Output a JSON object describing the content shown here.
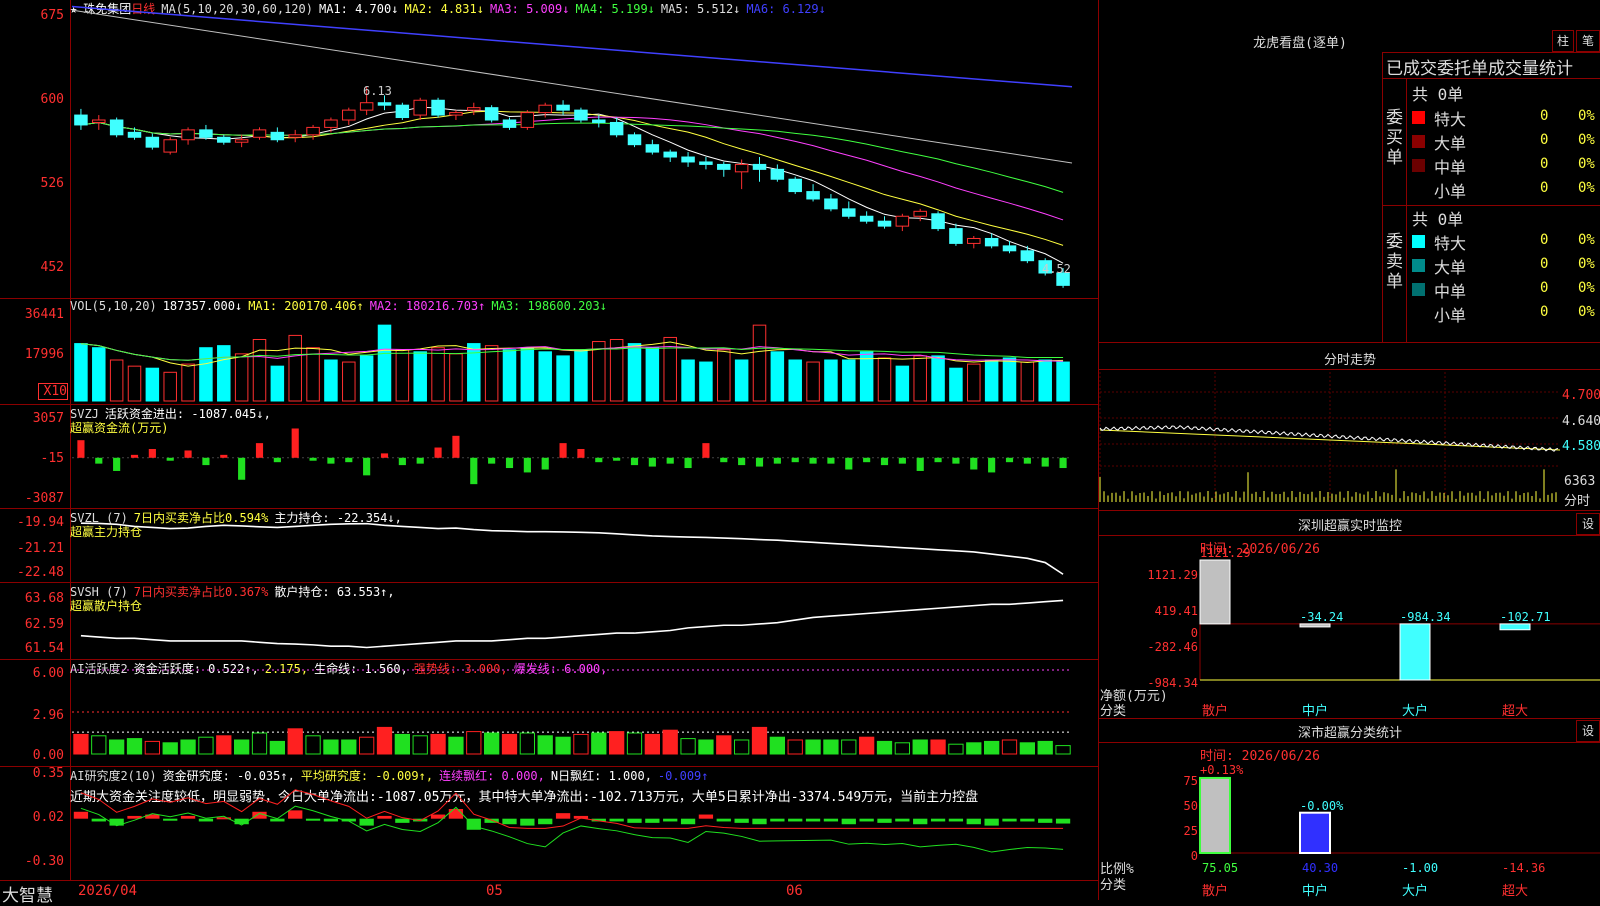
{
  "header": {
    "star": "★",
    "stock_name": "珠免集团",
    "period": "日线",
    "ma_main": "MA(5,10,20,30,60,120)",
    "ma1": "MA1: 4.700↓",
    "ma2": "MA2: 4.831↓",
    "ma3": "MA3: 5.009↓",
    "ma4": "MA4: 5.199↓",
    "ma5": "MA5: 5.512↓",
    "ma6": "MA6: 6.129↓"
  },
  "vol_header": {
    "name": "VOL(5,10,20)",
    "v": "187357.000↓",
    "ma1": "MA1: 200170.406↑",
    "ma2": "MA2: 180216.703↑",
    "ma3": "MA3: 198600.203↓"
  },
  "svzj_header": {
    "a": "SVZJ",
    "b": "活跃资金进出: -1087.045↓,",
    "c": "超赢资金流(万元)"
  },
  "svzl_header": {
    "a": "SVZL (7)",
    "b": "7日内买卖净占比0.594%",
    "c": "主力持仓: -22.354↓,",
    "d": "超赢主力持仓"
  },
  "svsh_header": {
    "a": "SVSH (7)",
    "b": "7日内买卖净占比0.367%",
    "c": "散户持仓: 63.553↑,",
    "d": "超赢散户持仓"
  },
  "ai1_header": {
    "a": "AI活跃度2",
    "b": "资金活跃度: 0.522↑,",
    "c": "2.175,",
    "d": "生命线: 1.560,",
    "e": "强势线: 3.000,",
    "f": "爆发线: 6.000,"
  },
  "ai2_header": {
    "a": "AI研究度2(10)",
    "b": "资金研究度: -0.035↑,",
    "c": "平均研究度: -0.009↑,",
    "d": "连续飘红: 0.000,",
    "e": "N日飘红: 1.000,",
    "f": "-0.009↑"
  },
  "ai2_note": "近期大资金关注度较低，明显弱势，今日大单净流出:-1087.05万元，其中特大单净流出:-102.713万元，大单5日累计净出-3374.549万元，当前主力控盘",
  "axis": {
    "price": [
      "675",
      "600",
      "526",
      "452"
    ],
    "vol": [
      "36441",
      "17996",
      "X10"
    ],
    "svzj": [
      "3057",
      "-15",
      "-3087"
    ],
    "svzl": [
      "-19.94",
      "-21.21",
      "-22.48"
    ],
    "svsh": [
      "63.68",
      "62.59",
      "61.54"
    ],
    "ai1": [
      "6.00",
      "2.96",
      "0.00"
    ],
    "ai2": [
      "0.35",
      "0.02",
      "-0.30"
    ]
  },
  "price_annotations": {
    "high": "6.13",
    "low": "4.52"
  },
  "date_axis": {
    "start": "2026/04",
    "m5": "05",
    "m6": "06"
  },
  "bottom_left": "大智慧",
  "longhu": {
    "title": "龙虎看盘(逐单)",
    "btn1": "柱",
    "btn2": "笔",
    "subtitle": "已成交委托单成交量统计",
    "buy_label": "委买单",
    "sell_label": "委卖单",
    "buy_total": "共 0单",
    "sell_total": "共 0单",
    "buy_rows": [
      {
        "name": "特大",
        "count": "0",
        "pct": "0%",
        "color": "#ff0000"
      },
      {
        "name": "大单",
        "count": "0",
        "pct": "0%",
        "color": "#8b0000"
      },
      {
        "name": "中单",
        "count": "0",
        "pct": "0%",
        "color": "#6b0000"
      },
      {
        "name": "小单",
        "count": "0",
        "pct": "0%",
        "color": "#000000"
      }
    ],
    "sell_rows": [
      {
        "name": "特大",
        "count": "0",
        "pct": "0%",
        "color": "#00ffff"
      },
      {
        "name": "大单",
        "count": "0",
        "pct": "0%",
        "color": "#008b8b"
      },
      {
        "name": "中单",
        "count": "0",
        "pct": "0%",
        "color": "#007070"
      },
      {
        "name": "小单",
        "count": "0",
        "pct": "0%",
        "color": "#000000"
      }
    ]
  },
  "intraday": {
    "title": "分时走势",
    "labels": [
      "4.700",
      "4.640",
      "4.580"
    ],
    "vol_label": "6363",
    "time_label": "分时"
  },
  "monitor": {
    "title": "深圳超赢实时监控",
    "btn": "设",
    "time": "时间: 2026/06/26",
    "unit": "净额(万元)",
    "cat_title": "分类",
    "axis": [
      "1121.29",
      "419.41",
      "0",
      "-282.46",
      "-984.34"
    ],
    "cats": [
      "散户",
      "中户",
      "大户",
      "超大"
    ],
    "values": [
      "1121.29",
      "-34.24",
      "-984.34",
      "-102.71"
    ]
  },
  "classify": {
    "title": "深市超赢分类统计",
    "btn": "设",
    "time": "时间: 2026/06/26",
    "unit": "比例%",
    "cat_title": "分类",
    "axis": [
      "75",
      "50",
      "25",
      "0"
    ],
    "cats": [
      "散户",
      "中户",
      "大户",
      "超大"
    ],
    "values": [
      "75.05",
      "40.30",
      "-1.00",
      "-14.36"
    ],
    "top_labels": [
      "+0.13%",
      "-0.00%"
    ]
  },
  "chart_data": [
    {
      "type": "candlestick",
      "title": "珠免集团 日线",
      "x_labels": [
        "2026/04",
        "05",
        "06"
      ],
      "ylim": [
        4.45,
        6.8
      ],
      "ohlc": [
        [
          5.9,
          5.95,
          5.78,
          5.82
        ],
        [
          5.84,
          5.9,
          5.78,
          5.86
        ],
        [
          5.86,
          5.88,
          5.72,
          5.74
        ],
        [
          5.76,
          5.8,
          5.7,
          5.72
        ],
        [
          5.72,
          5.75,
          5.62,
          5.64
        ],
        [
          5.6,
          5.72,
          5.58,
          5.7
        ],
        [
          5.7,
          5.8,
          5.66,
          5.78
        ],
        [
          5.78,
          5.82,
          5.7,
          5.72
        ],
        [
          5.72,
          5.74,
          5.66,
          5.68
        ],
        [
          5.68,
          5.74,
          5.64,
          5.7
        ],
        [
          5.72,
          5.8,
          5.7,
          5.78
        ],
        [
          5.76,
          5.8,
          5.68,
          5.7
        ],
        [
          5.72,
          5.78,
          5.68,
          5.74
        ],
        [
          5.74,
          5.82,
          5.7,
          5.8
        ],
        [
          5.8,
          5.88,
          5.76,
          5.86
        ],
        [
          5.86,
          5.96,
          5.82,
          5.94
        ],
        [
          5.94,
          6.13,
          5.9,
          6.0
        ],
        [
          6.0,
          6.06,
          5.94,
          5.98
        ],
        [
          5.98,
          6.0,
          5.86,
          5.88
        ],
        [
          5.9,
          6.04,
          5.86,
          6.02
        ],
        [
          6.02,
          6.04,
          5.88,
          5.9
        ],
        [
          5.9,
          5.94,
          5.86,
          5.92
        ],
        [
          5.94,
          6.0,
          5.9,
          5.96
        ],
        [
          5.96,
          5.98,
          5.84,
          5.86
        ],
        [
          5.86,
          5.88,
          5.78,
          5.8
        ],
        [
          5.8,
          5.94,
          5.78,
          5.92
        ],
        [
          5.92,
          6.0,
          5.88,
          5.98
        ],
        [
          5.98,
          6.02,
          5.9,
          5.94
        ],
        [
          5.94,
          5.96,
          5.84,
          5.86
        ],
        [
          5.86,
          5.9,
          5.8,
          5.84
        ],
        [
          5.84,
          5.88,
          5.72,
          5.74
        ],
        [
          5.74,
          5.76,
          5.64,
          5.66
        ],
        [
          5.66,
          5.7,
          5.58,
          5.6
        ],
        [
          5.6,
          5.62,
          5.52,
          5.56
        ],
        [
          5.56,
          5.6,
          5.48,
          5.52
        ],
        [
          5.52,
          5.56,
          5.46,
          5.5
        ],
        [
          5.5,
          5.52,
          5.4,
          5.46
        ],
        [
          5.44,
          5.54,
          5.3,
          5.5
        ],
        [
          5.5,
          5.56,
          5.36,
          5.46
        ],
        [
          5.46,
          5.5,
          5.36,
          5.38
        ],
        [
          5.38,
          5.4,
          5.26,
          5.28
        ],
        [
          5.28,
          5.34,
          5.2,
          5.22
        ],
        [
          5.22,
          5.26,
          5.12,
          5.14
        ],
        [
          5.14,
          5.2,
          5.06,
          5.08
        ],
        [
          5.08,
          5.12,
          5.02,
          5.04
        ],
        [
          5.04,
          5.08,
          4.98,
          5.0
        ],
        [
          5.0,
          5.1,
          4.96,
          5.08
        ],
        [
          5.08,
          5.14,
          5.04,
          5.12
        ],
        [
          5.1,
          5.12,
          4.96,
          4.98
        ],
        [
          4.98,
          5.02,
          4.84,
          4.86
        ],
        [
          4.86,
          4.92,
          4.82,
          4.9
        ],
        [
          4.9,
          4.94,
          4.82,
          4.84
        ],
        [
          4.84,
          4.88,
          4.78,
          4.8
        ],
        [
          4.8,
          4.84,
          4.7,
          4.72
        ],
        [
          4.72,
          4.74,
          4.6,
          4.62
        ],
        [
          4.62,
          4.66,
          4.5,
          4.52
        ]
      ]
    },
    {
      "type": "bar",
      "title": "VOL(5,10,20)",
      "ylim": [
        0,
        40000
      ],
      "values": [
        28000,
        26000,
        20000,
        17000,
        16000,
        14000,
        18000,
        26000,
        27000,
        23000,
        30000,
        17000,
        32000,
        26000,
        20000,
        19000,
        22000,
        37000,
        25000,
        24000,
        26000,
        23000,
        28000,
        27000,
        25000,
        26000,
        24000,
        22000,
        25000,
        29000,
        30000,
        28000,
        26000,
        31000,
        20000,
        19000,
        25000,
        20000,
        37000,
        24000,
        20000,
        19000,
        20000,
        20000,
        24000,
        21000,
        17000,
        22000,
        22000,
        16000,
        18000,
        20000,
        21000,
        19000,
        20000,
        19000
      ],
      "colors_up": [
        false,
        false,
        true,
        true,
        false,
        true,
        true,
        false,
        false,
        true,
        true,
        false,
        true,
        true,
        false,
        true,
        false,
        false,
        true,
        false,
        true,
        true,
        false,
        true,
        false,
        false,
        false,
        false,
        false,
        true,
        true,
        false,
        false,
        true,
        false,
        false,
        true,
        false,
        true,
        false,
        false,
        true,
        false,
        false,
        false,
        true,
        false,
        true,
        false,
        false,
        true,
        false,
        false,
        true,
        false,
        false
      ]
    },
    {
      "type": "bar",
      "title": "超赢资金流(万元)",
      "ylim": [
        -3087,
        3057
      ],
      "values": [
        1200,
        -400,
        -900,
        200,
        600,
        -200,
        500,
        -500,
        200,
        -1500,
        1000,
        -300,
        2000,
        -200,
        -400,
        -300,
        -1200,
        300,
        -500,
        -400,
        700,
        1500,
        -1800,
        -400,
        -700,
        -1000,
        -800,
        1000,
        600,
        -300,
        -200,
        -500,
        -600,
        -400,
        -700,
        1000,
        -300,
        -500,
        -600,
        -400,
        -300,
        -400,
        -400,
        -800,
        -300,
        -500,
        -400,
        -900,
        -300,
        -400,
        -800,
        -1000,
        -300,
        -400,
        -600,
        -700
      ]
    },
    {
      "type": "line",
      "title": "超赢主力持仓",
      "ylim": [
        -22.48,
        -19.94
      ],
      "values": [
        -19.95,
        -19.96,
        -20.0,
        -20.1,
        -20.15,
        -20.2,
        -20.18,
        -20.1,
        -20.05,
        -20.08,
        -20.12,
        -20.15,
        -20.1,
        -20.05,
        -20.0,
        -19.98,
        -19.97,
        -20.05,
        -20.1,
        -20.15,
        -20.2,
        -20.18,
        -20.25,
        -20.3,
        -20.32,
        -20.35,
        -20.35,
        -20.36,
        -20.38,
        -20.4,
        -20.45,
        -20.5,
        -20.55,
        -20.58,
        -20.6,
        -20.62,
        -20.65,
        -20.68,
        -20.72,
        -20.75,
        -20.8,
        -20.85,
        -20.9,
        -20.95,
        -21.0,
        -21.05,
        -21.1,
        -21.15,
        -21.2,
        -21.25,
        -21.3,
        -21.4,
        -21.5,
        -21.6,
        -21.8,
        -22.35
      ]
    },
    {
      "type": "line",
      "title": "超赢散户持仓",
      "ylim": [
        61.54,
        63.68
      ],
      "values": [
        62.2,
        62.15,
        62.1,
        62.1,
        62.05,
        62.0,
        62.0,
        62.0,
        62.0,
        62.0,
        61.95,
        61.9,
        61.88,
        61.85,
        61.8,
        61.8,
        61.75,
        61.8,
        61.85,
        61.9,
        61.95,
        62.0,
        62.0,
        62.0,
        62.05,
        62.1,
        62.1,
        62.15,
        62.2,
        62.25,
        62.3,
        62.3,
        62.35,
        62.4,
        62.5,
        62.55,
        62.6,
        62.6,
        62.65,
        62.7,
        62.8,
        62.9,
        62.95,
        63.0,
        63.05,
        63.1,
        63.15,
        63.2,
        63.25,
        63.3,
        63.35,
        63.4,
        63.4,
        63.45,
        63.5,
        63.55
      ]
    },
    {
      "type": "bar",
      "title": "AI活跃度2",
      "ylim": [
        0,
        6
      ],
      "values": [
        1.4,
        1.3,
        1.0,
        1.1,
        0.9,
        0.8,
        1.0,
        1.2,
        1.3,
        1.0,
        1.5,
        0.9,
        1.8,
        1.3,
        1.0,
        1.0,
        1.2,
        1.9,
        1.4,
        1.3,
        1.4,
        1.2,
        1.6,
        1.5,
        1.4,
        1.5,
        1.3,
        1.2,
        1.4,
        1.5,
        1.6,
        1.5,
        1.4,
        1.7,
        1.1,
        1.0,
        1.3,
        1.0,
        1.9,
        1.2,
        1.0,
        1.0,
        1.0,
        1.0,
        1.2,
        0.9,
        0.8,
        1.0,
        1.0,
        0.7,
        0.8,
        0.9,
        1.0,
        0.8,
        0.9,
        0.6
      ],
      "lines": {
        "生命线": 1.56,
        "强势线": 3.0,
        "爆发线": 6.0
      }
    },
    {
      "type": "bar",
      "title": "AI研究度2(10)",
      "ylim": [
        -0.3,
        0.35
      ],
      "values": [
        0.05,
        -0.02,
        -0.05,
        0.02,
        0.03,
        -0.01,
        0.02,
        -0.02,
        0.01,
        -0.04,
        0.05,
        -0.02,
        0.06,
        -0.01,
        -0.02,
        -0.02,
        -0.05,
        0.02,
        -0.03,
        -0.02,
        0.03,
        0.07,
        -0.08,
        -0.03,
        -0.04,
        -0.05,
        -0.04,
        0.04,
        0.02,
        -0.02,
        -0.02,
        -0.03,
        -0.03,
        -0.02,
        -0.04,
        0.03,
        -0.02,
        -0.03,
        -0.04,
        -0.02,
        -0.02,
        -0.02,
        -0.02,
        -0.04,
        -0.02,
        -0.03,
        -0.02,
        -0.04,
        -0.02,
        -0.02,
        -0.04,
        -0.05,
        -0.02,
        -0.02,
        -0.03,
        -0.035
      ]
    },
    {
      "type": "bar",
      "title": "深圳超赢实时监控",
      "categories": [
        "散户",
        "中户",
        "大户",
        "超大"
      ],
      "values": [
        1121.29,
        -34.24,
        -984.34,
        -102.71
      ],
      "ylim": [
        -984.34,
        1121.29
      ]
    },
    {
      "type": "bar",
      "title": "深市超赢分类统计",
      "categories": [
        "散户",
        "中户",
        "大户",
        "超大"
      ],
      "values": [
        75.05,
        40.3,
        -1.0,
        -14.36
      ],
      "ylim": [
        0,
        75
      ]
    }
  ]
}
